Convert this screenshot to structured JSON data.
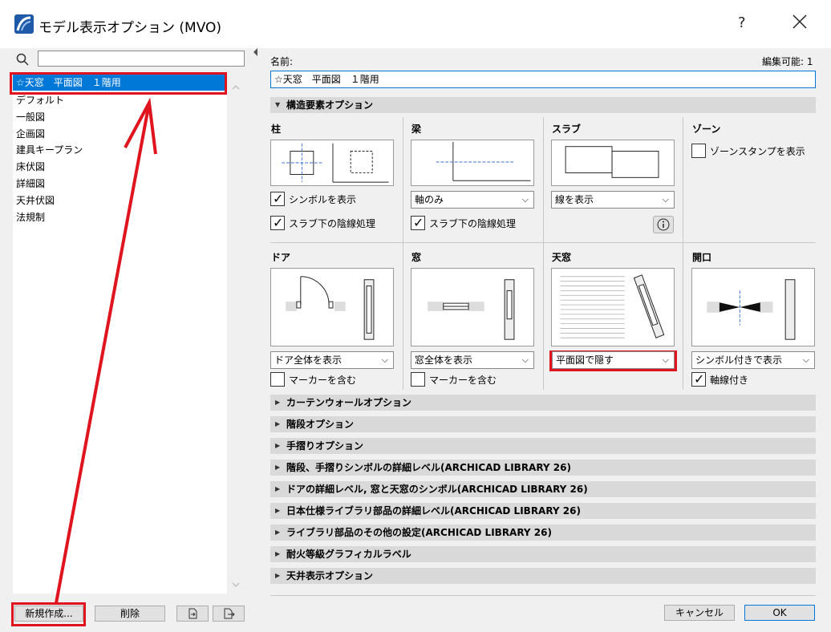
{
  "window": {
    "title": "モデル表示オプション (MVO)",
    "help_label": "?",
    "close_icon": "close-icon"
  },
  "left": {
    "search_placeholder": "",
    "items": [
      "☆天窓　平面図　１階用",
      "デフォルト",
      "一般図",
      "企画図",
      "建具キープラン",
      "床伏図",
      "詳細図",
      "天井伏図",
      "法規制"
    ],
    "new_button": "新規作成...",
    "delete_button": "削除"
  },
  "right": {
    "name_label": "名前:",
    "editable_label": "編集可能: 1",
    "name_value": "☆天窓　平面図　１階用",
    "structural_header": "構造要素オプション",
    "column": {
      "title": "柱",
      "symbol_check": "シンボルを表示",
      "slab_check": "スラブ下の陰線処理"
    },
    "beam": {
      "title": "梁",
      "dropdown": "軸のみ",
      "slab_check": "スラブ下の陰線処理"
    },
    "slab": {
      "title": "スラブ",
      "dropdown": "線を表示"
    },
    "zone": {
      "title": "ゾーン",
      "stamp_check": "ゾーンスタンプを表示"
    },
    "door": {
      "title": "ドア",
      "dropdown": "ドア全体を表示",
      "marker_check": "マーカーを含む"
    },
    "window_el": {
      "title": "窓",
      "dropdown": "窓全体を表示",
      "marker_check": "マーカーを含む"
    },
    "skylight": {
      "title": "天窓",
      "dropdown": "平面図で隠す"
    },
    "opening": {
      "title": "開口",
      "dropdown": "シンボル付きで表示",
      "axis_check": "軸線付き"
    },
    "sections": [
      "カーテンウォールオプション",
      "階段オプション",
      "手摺りオプション",
      "階段、手摺りシンボルの詳細レベル(ARCHICAD LIBRARY 26)",
      "ドアの詳細レベル, 窓と天窓のシンボル(ARCHICAD LIBRARY 26)",
      "日本仕様ライブラリ部品の詳細レベル(ARCHICAD LIBRARY 26)",
      "ライブラリ部品のその他の設定(ARCHICAD LIBRARY 26)",
      "耐火等級グラフィカルラベル",
      "天井表示オプション"
    ],
    "cancel_button": "キャンセル",
    "ok_button": "OK"
  },
  "colors": {
    "selection": "#0078d7",
    "annotation_red": "#e0141e"
  }
}
